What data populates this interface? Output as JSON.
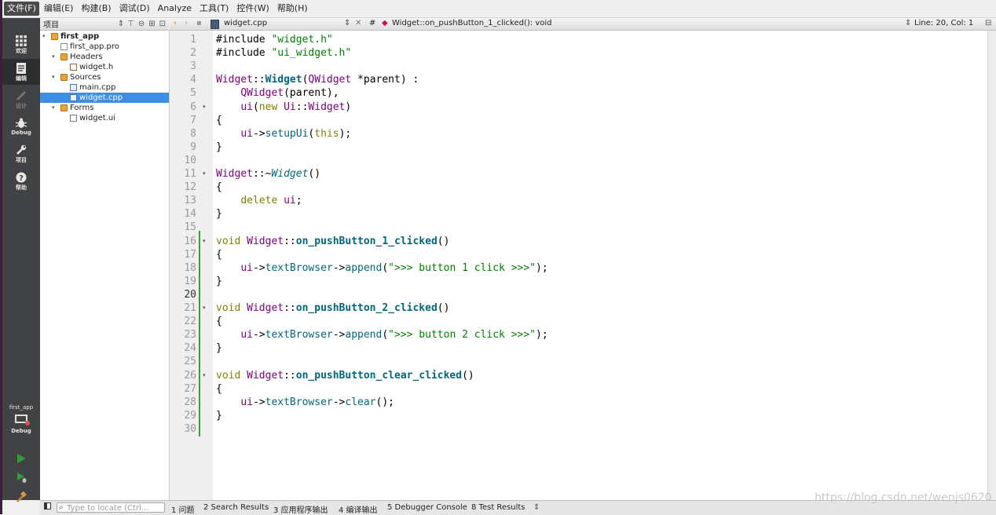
{
  "menu": [
    "文件(F)",
    "编辑(E)",
    "构建(B)",
    "调试(D)",
    "Analyze",
    "工具(T)",
    "控件(W)",
    "帮助(H)"
  ],
  "modes": [
    {
      "label": "欢迎",
      "icon": "grid-icon"
    },
    {
      "label": "编辑",
      "icon": "document-edit-icon"
    },
    {
      "label": "设计",
      "icon": "pencil-icon"
    },
    {
      "label": "Debug",
      "icon": "bug-icon"
    },
    {
      "label": "项目",
      "icon": "wrench-icon"
    },
    {
      "label": "帮助",
      "icon": "help-icon"
    }
  ],
  "kit": {
    "project": "first_app",
    "config": "Debug"
  },
  "project_pane": {
    "title": "项目",
    "tree": [
      {
        "label": "first_app",
        "type": "proj",
        "level": 0,
        "arrow": "▾",
        "bold": true
      },
      {
        "label": "first_app.pro",
        "type": "file",
        "level": 1,
        "arrow": ""
      },
      {
        "label": "Headers",
        "type": "folder",
        "level": 1,
        "arrow": "▾"
      },
      {
        "label": "widget.h",
        "type": "h",
        "level": 2,
        "arrow": ""
      },
      {
        "label": "Sources",
        "type": "folder",
        "level": 1,
        "arrow": "▾"
      },
      {
        "label": "main.cpp",
        "type": "cpp",
        "level": 2,
        "arrow": ""
      },
      {
        "label": "widget.cpp",
        "type": "cpp",
        "level": 2,
        "arrow": "",
        "selected": true
      },
      {
        "label": "Forms",
        "type": "folder",
        "level": 1,
        "arrow": "▾"
      },
      {
        "label": "widget.ui",
        "type": "ui",
        "level": 2,
        "arrow": ""
      }
    ]
  },
  "editor": {
    "file_tab": "widget.cpp",
    "hash": "#",
    "symbol": "Widget::on_pushButton_1_clicked(): void",
    "position": "Line: 20, Col: 1",
    "current_line": 20,
    "lines": [
      [
        [
          "#include ",
          "t"
        ],
        [
          "\"widget.h\"",
          "str"
        ]
      ],
      [
        [
          "#include ",
          "t"
        ],
        [
          "\"ui_widget.h\"",
          "str"
        ]
      ],
      [],
      [
        [
          "Widget",
          "cls"
        ],
        [
          "::",
          "t"
        ],
        [
          "Widget",
          "fnb"
        ],
        [
          "(",
          "t"
        ],
        [
          "QWidget",
          "cls"
        ],
        [
          " *parent) :",
          "t"
        ]
      ],
      [
        [
          "    ",
          "t"
        ],
        [
          "QWidget",
          "cls"
        ],
        [
          "(parent),",
          "t"
        ]
      ],
      [
        [
          "    ",
          "t"
        ],
        [
          "ui",
          "cls"
        ],
        [
          "(",
          "t"
        ],
        [
          "new",
          "kw"
        ],
        [
          " ",
          "t"
        ],
        [
          "Ui",
          "cls"
        ],
        [
          "::",
          "t"
        ],
        [
          "Widget",
          "cls"
        ],
        [
          ")",
          "t"
        ]
      ],
      [
        [
          "{",
          "t"
        ]
      ],
      [
        [
          "    ",
          "t"
        ],
        [
          "ui",
          "cls"
        ],
        [
          "->",
          "t"
        ],
        [
          "setupUi",
          "fn"
        ],
        [
          "(",
          "t"
        ],
        [
          "this",
          "kw"
        ],
        [
          ");",
          "t"
        ]
      ],
      [
        [
          "}",
          "t"
        ]
      ],
      [],
      [
        [
          "Widget",
          "cls"
        ],
        [
          "::~",
          "t"
        ],
        [
          "Widget",
          "fni"
        ],
        [
          "()",
          "t"
        ]
      ],
      [
        [
          "{",
          "t"
        ]
      ],
      [
        [
          "    ",
          "t"
        ],
        [
          "delete",
          "kw"
        ],
        [
          " ",
          "t"
        ],
        [
          "ui",
          "cls"
        ],
        [
          ";",
          "t"
        ]
      ],
      [
        [
          "}",
          "t"
        ]
      ],
      [],
      [
        [
          "void",
          "kw"
        ],
        [
          " ",
          "t"
        ],
        [
          "Widget",
          "cls"
        ],
        [
          "::",
          "t"
        ],
        [
          "on_pushButton_1_clicked",
          "fnb"
        ],
        [
          "()",
          "t"
        ]
      ],
      [
        [
          "{",
          "t"
        ]
      ],
      [
        [
          "    ",
          "t"
        ],
        [
          "ui",
          "cls"
        ],
        [
          "->",
          "t"
        ],
        [
          "textBrowser",
          "fn"
        ],
        [
          "->",
          "t"
        ],
        [
          "append",
          "fn"
        ],
        [
          "(",
          "t"
        ],
        [
          "\">>> button 1 click >>>\"",
          "str"
        ],
        [
          ");",
          "t"
        ]
      ],
      [
        [
          "}",
          "t"
        ]
      ],
      [],
      [
        [
          "void",
          "kw"
        ],
        [
          " ",
          "t"
        ],
        [
          "Widget",
          "cls"
        ],
        [
          "::",
          "t"
        ],
        [
          "on_pushButton_2_clicked",
          "fnb"
        ],
        [
          "()",
          "t"
        ]
      ],
      [
        [
          "{",
          "t"
        ]
      ],
      [
        [
          "    ",
          "t"
        ],
        [
          "ui",
          "cls"
        ],
        [
          "->",
          "t"
        ],
        [
          "textBrowser",
          "fn"
        ],
        [
          "->",
          "t"
        ],
        [
          "append",
          "fn"
        ],
        [
          "(",
          "t"
        ],
        [
          "\">>> button 2 click >>>\"",
          "str"
        ],
        [
          ");",
          "t"
        ]
      ],
      [
        [
          "}",
          "t"
        ]
      ],
      [],
      [
        [
          "void",
          "kw"
        ],
        [
          " ",
          "t"
        ],
        [
          "Widget",
          "cls"
        ],
        [
          "::",
          "t"
        ],
        [
          "on_pushButton_clear_clicked",
          "fnb"
        ],
        [
          "()",
          "t"
        ]
      ],
      [
        [
          "{",
          "t"
        ]
      ],
      [
        [
          "    ",
          "t"
        ],
        [
          "ui",
          "cls"
        ],
        [
          "->",
          "t"
        ],
        [
          "textBrowser",
          "fn"
        ],
        [
          "->",
          "t"
        ],
        [
          "clear",
          "fn"
        ],
        [
          "();",
          "t"
        ]
      ],
      [
        [
          "}",
          "t"
        ]
      ],
      []
    ],
    "fold_lines": [
      6,
      11,
      16,
      21,
      26
    ]
  },
  "statusbar": {
    "locate_placeholder": "Type to locate (Ctrl...",
    "tabs": [
      "1 问题",
      "2 Search Results",
      "3 应用程序输出",
      "4 编译输出",
      "5 Debugger Console",
      "8 Test Results"
    ]
  },
  "watermark": "https://blog.csdn.net/wenjs0620",
  "colors": {
    "keyword": "#808000",
    "string": "#008000",
    "class": "#800080",
    "function": "#00677c",
    "selection": "#3d8ee5",
    "modebar": "#404244"
  }
}
